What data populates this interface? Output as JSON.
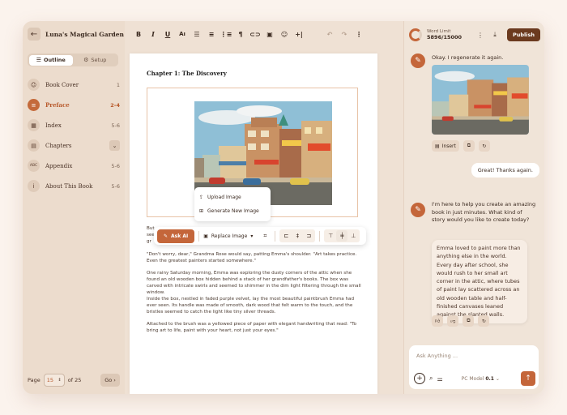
{
  "sidebar": {
    "book_title": "Luna's Magical Garden",
    "tabs": [
      {
        "label": "Outline",
        "icon": "list-icon"
      },
      {
        "label": "Setup",
        "icon": "gear-icon"
      }
    ],
    "items": [
      {
        "label": "Book Cover",
        "pages": "1",
        "icon": "cover-icon"
      },
      {
        "label": "Preface",
        "pages": "2-4",
        "icon": "list-icon",
        "active": true
      },
      {
        "label": "Index",
        "pages": "5-6",
        "icon": "index-icon"
      },
      {
        "label": "Chapters",
        "pages": "",
        "icon": "document-icon"
      },
      {
        "label": "Appendix",
        "pages": "5-6",
        "icon": "appendix-icon"
      },
      {
        "label": "About This Book",
        "pages": "5-6",
        "icon": "info-icon"
      }
    ],
    "pager": {
      "label": "Page",
      "current": "15",
      "of_text": "of 25",
      "go": "Go"
    }
  },
  "editor": {
    "chapter_title": "Chapter 1: The Discovery",
    "popup": {
      "upload": "Upload Image",
      "generate": "Generate New Image"
    },
    "image_toolbar": {
      "ask_ai": "Ask AI",
      "replace": "Replace Image"
    },
    "partial_lines": [
      "But",
      "see",
      "gr"
    ],
    "paragraphs": [
      "\"Don't worry, dear,\" Grandma Rose would say, patting Emma's shoulder. \"Art takes practice. Even the greatest painters started somewhere.\"",
      "One rainy Saturday morning, Emma was exploring the dusty corners of the attic when she found an old wooden box hidden behind a stack of her grandfather's books. The box was carved with intricate swirls and seemed to shimmer in the dim light filtering through the small window.",
      "Inside the box, nestled in faded purple velvet, lay the most beautiful paintbrush Emma had ever seen. Its handle was made of smooth, dark wood that felt warm to the touch, and the bristles seemed to catch the light like tiny silver threads.",
      "Attached to the brush was a yellowed piece of paper with elegant handwriting that read: \"To bring art to life, paint with your heart, not just your eyes.\""
    ]
  },
  "chat": {
    "word_limit_label": "Word Limit",
    "word_limit_value": "5896/15000",
    "publish": "Publish",
    "messages": {
      "ai_1": "Okay. I regenerate it again.",
      "insert": "Insert",
      "user_1": "Great! Thanks again.",
      "ai_2": "I'm here to help you create an amazing book in just minutes. What kind of story would you like to create today?",
      "generated": "Emma loved to paint more than anything else in the world. Every day after school, she would rush to her small art corner in the attic, where tubes of paint lay scattered across an old wooden table and half-finished canvases leaned against the slanted walls."
    },
    "input_placeholder": "Ask Anything ...",
    "model": "PC Model",
    "model_version": "0.1"
  },
  "colors": {
    "accent": "#c4663a",
    "publish": "#6b3a1f",
    "background": "#efe1d4"
  }
}
